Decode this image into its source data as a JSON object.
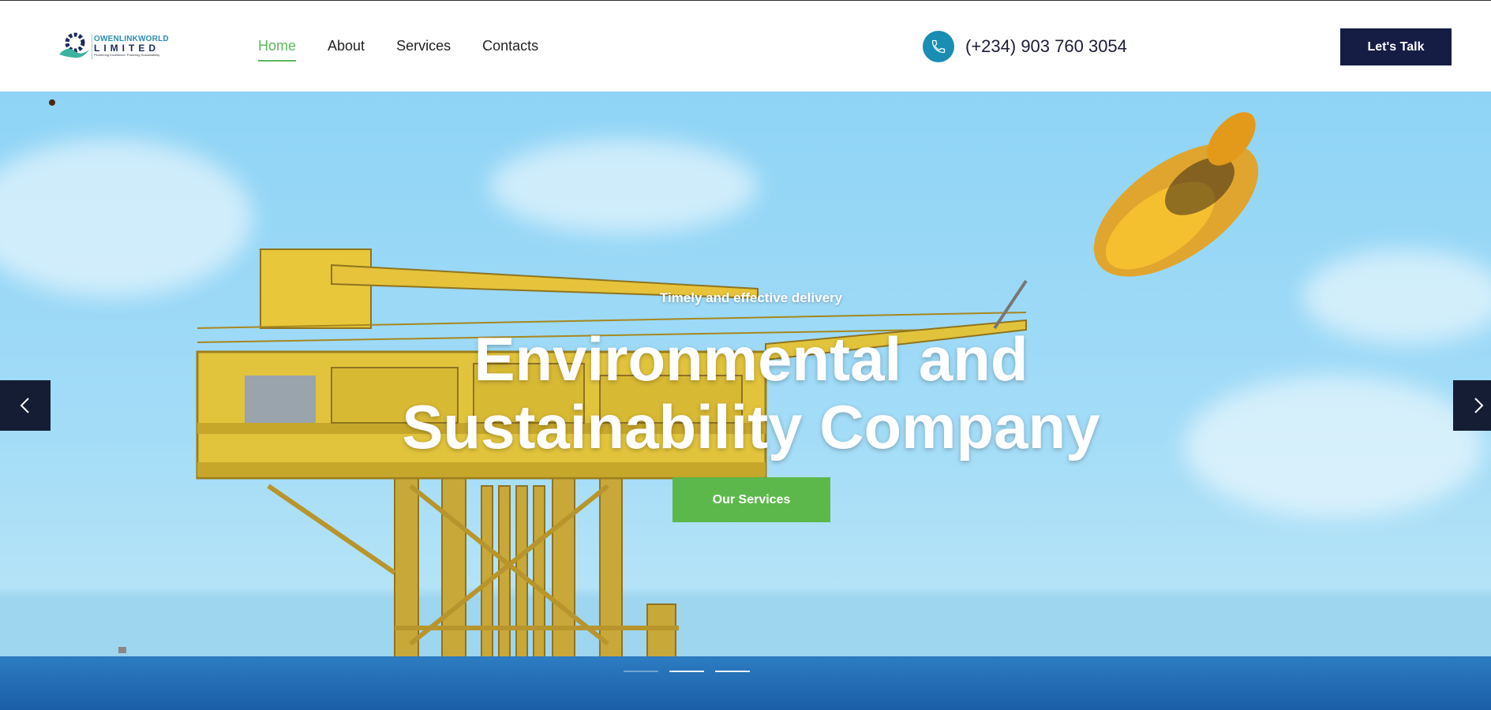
{
  "brand": {
    "line1": "OWENLINKWORLD",
    "line2": "LIMITED",
    "tagline": "Pioneering Excellence. Powering Sustainability."
  },
  "nav": {
    "items": [
      {
        "label": "Home",
        "active": true
      },
      {
        "label": "About",
        "active": false
      },
      {
        "label": "Services",
        "active": false
      },
      {
        "label": "Contacts",
        "active": false
      }
    ]
  },
  "contact": {
    "phone": "(+234) 903 760 3054",
    "icon": "phone-icon"
  },
  "header": {
    "cta_label": "Let's Talk"
  },
  "hero": {
    "subtitle": "Timely and effective delivery",
    "title_line1": "Environmental and",
    "title_line2": "Sustainability Company",
    "button_label": "Our Services",
    "slides_count": 3,
    "active_slide": 1
  },
  "colors": {
    "accent_green": "#5cb84a",
    "navy": "#151d45",
    "phone_blue": "#1a8db3"
  }
}
